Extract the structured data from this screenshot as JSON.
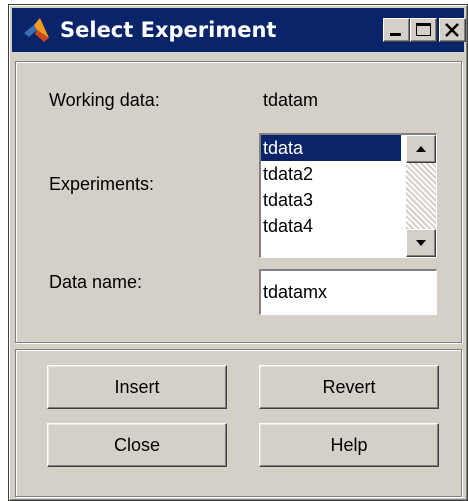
{
  "window": {
    "title": "Select Experiment"
  },
  "working_data": {
    "label": "Working data:",
    "value": "tdatam"
  },
  "experiments": {
    "label": "Experiments:",
    "items": [
      "tdata",
      "tdata2",
      "tdata3",
      "tdata4"
    ],
    "selected_index": 0
  },
  "data_name": {
    "label": "Data name:",
    "value": "tdatamx"
  },
  "buttons": {
    "insert": "Insert",
    "revert": "Revert",
    "close": "Close",
    "help": "Help"
  },
  "colors": {
    "titlebar": "#0a246a",
    "face": "#d4d0c8",
    "selection": "#0a246a"
  },
  "icons": {
    "app": "matlab-logo-icon",
    "minimize": "minimize-icon",
    "maximize": "maximize-icon",
    "close": "close-icon",
    "scroll_up": "arrow-up-icon",
    "scroll_down": "arrow-down-icon"
  }
}
